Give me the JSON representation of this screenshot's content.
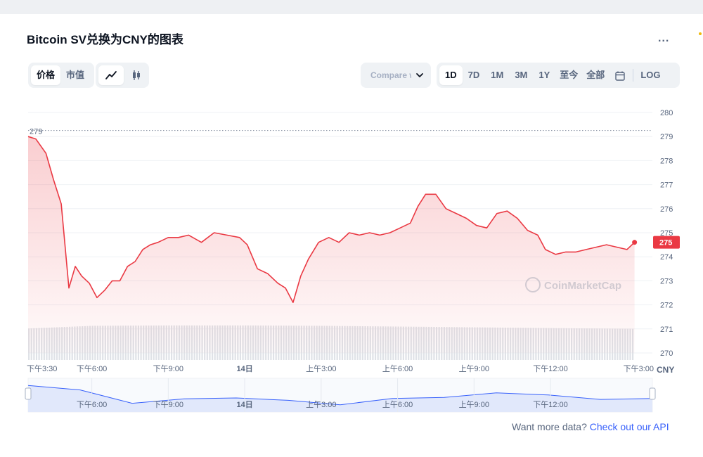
{
  "page": {
    "title": "Bitcoin SV兑换为CNY的图表",
    "more_label": "...",
    "footer_text": "Want more data?",
    "footer_link": "Check out our API",
    "watermark": "CoinMarketCap"
  },
  "toolbar": {
    "metric_tabs": [
      {
        "label": "价格",
        "active": true
      },
      {
        "label": "市值",
        "active": false
      }
    ],
    "chart_type_icons": [
      {
        "icon": "line-chart-icon",
        "active": true
      },
      {
        "icon": "candlestick-icon",
        "active": false
      }
    ],
    "compare_label": "Compare with",
    "ranges": [
      {
        "label": "1D",
        "active": true
      },
      {
        "label": "7D",
        "active": false
      },
      {
        "label": "1M",
        "active": false
      },
      {
        "label": "3M",
        "active": false
      },
      {
        "label": "1Y",
        "active": false
      },
      {
        "label": "至今",
        "active": false
      },
      {
        "label": "全部",
        "active": false
      }
    ],
    "calendar_icon": "calendar-icon",
    "log_label": "LOG"
  },
  "colors": {
    "line": "#ea3943",
    "fill_top": "#ea3943",
    "volume": "#dfe2e7",
    "nav_line": "#3861fb",
    "nav_fill": "#e1e8fb"
  },
  "chart_data": {
    "type": "area",
    "currency_label": "CNY",
    "ylim": [
      270,
      280
    ],
    "y_ticks": [
      280,
      279,
      278,
      277,
      276,
      275,
      274,
      273,
      272,
      271,
      270
    ],
    "start_price_label": "279",
    "start_price": 279.25,
    "current_price": 274.6,
    "current_price_label": "275",
    "x_tick_labels": [
      "下午3:30",
      "下午6:00",
      "下午9:00",
      "14日",
      "上午3:00",
      "上午6:00",
      "上午9:00",
      "下午12:00",
      "下午3:00"
    ],
    "x_tick_hours": [
      0,
      2.5,
      5.5,
      8.5,
      11.5,
      14.5,
      17.5,
      20.5,
      23.5
    ],
    "x_range_hours": [
      0,
      24.5
    ],
    "navigator_labels": [
      "下午6:00",
      "下午9:00",
      "14日",
      "上午3:00",
      "上午6:00",
      "上午9:00",
      "下午12:00"
    ],
    "navigator_hours": [
      2.5,
      5.5,
      8.5,
      11.5,
      14.5,
      17.5,
      20.5
    ],
    "price": {
      "hours": [
        0,
        0.3,
        0.7,
        1.0,
        1.3,
        1.6,
        1.85,
        2.1,
        2.4,
        2.7,
        3.0,
        3.3,
        3.6,
        3.9,
        4.2,
        4.5,
        4.8,
        5.1,
        5.5,
        5.9,
        6.3,
        6.8,
        7.3,
        7.8,
        8.3,
        8.6,
        9.0,
        9.4,
        9.8,
        10.1,
        10.4,
        10.7,
        11.0,
        11.4,
        11.8,
        12.2,
        12.6,
        13.0,
        13.4,
        13.8,
        14.2,
        14.6,
        15.0,
        15.3,
        15.6,
        16.0,
        16.4,
        16.8,
        17.2,
        17.6,
        18.0,
        18.4,
        18.8,
        19.2,
        19.6,
        20.0,
        20.3,
        20.7,
        21.1,
        21.5,
        21.9,
        22.3,
        22.7,
        23.1,
        23.5,
        23.8
      ],
      "values": [
        279.0,
        278.9,
        278.3,
        277.2,
        276.2,
        272.7,
        273.6,
        273.2,
        272.9,
        272.3,
        272.6,
        273.0,
        273.0,
        273.6,
        273.8,
        274.3,
        274.5,
        274.6,
        274.8,
        274.8,
        274.9,
        274.6,
        275.0,
        274.9,
        274.8,
        274.5,
        273.5,
        273.3,
        272.9,
        272.7,
        272.1,
        273.2,
        273.9,
        274.6,
        274.8,
        274.6,
        275.0,
        274.9,
        275.0,
        274.9,
        275.0,
        275.2,
        275.4,
        276.1,
        276.6,
        276.6,
        276.0,
        275.8,
        275.6,
        275.3,
        275.2,
        275.8,
        275.9,
        275.6,
        275.1,
        274.9,
        274.3,
        274.1,
        274.2,
        274.2,
        274.3,
        274.4,
        274.5,
        274.4,
        274.3,
        274.6
      ]
    },
    "volume": {
      "hours": [
        0,
        2.5,
        5.5,
        8.5,
        11.5,
        14.5,
        17.5,
        20.5,
        23.8
      ],
      "relative": [
        0.83,
        0.9,
        0.91,
        0.91,
        0.9,
        0.88,
        0.86,
        0.84,
        0.82
      ]
    },
    "navigator_values": [
      279.0,
      277.5,
      273.0,
      274.5,
      274.8,
      274.0,
      272.5,
      274.6,
      275.0,
      276.5,
      275.8,
      274.3,
      274.6
    ]
  }
}
